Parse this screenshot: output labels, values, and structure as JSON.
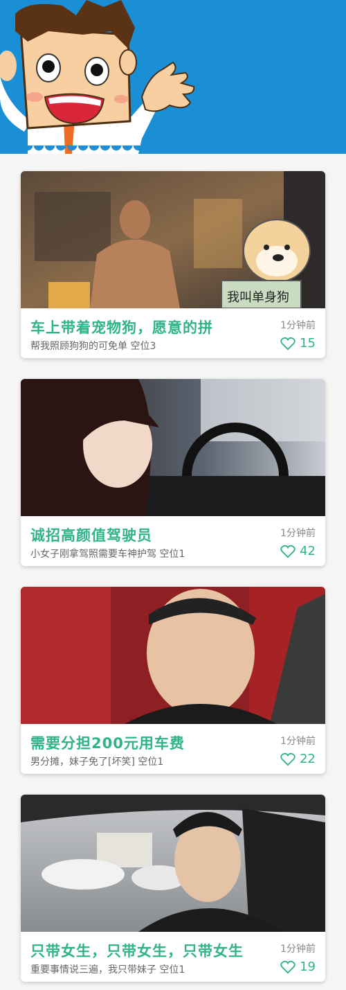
{
  "cards": [
    {
      "title": "车上带着宠物狗，愿意的拼",
      "subtitle": "帮我照顾狗狗的可免单  空位3",
      "time": "1分钟前",
      "likes": "15",
      "sign_text": "我叫单身狗"
    },
    {
      "title": "诚招高颜值驾驶员",
      "subtitle": "小女子刚拿驾照需要车神护驾  空位1",
      "time": "1分钟前",
      "likes": "42"
    },
    {
      "title": "需要分担200元用车费",
      "subtitle": "男分摊，妹子免了[坏笑]  空位1",
      "time": "1分钟前",
      "likes": "22"
    },
    {
      "title": "只带女生，只带女生，只带女生",
      "subtitle": "重要事情说三遍，我只带妹子  空位1",
      "time": "1分钟前",
      "likes": "19"
    }
  ],
  "colors": {
    "header": "#1b8fd6",
    "accent": "#2fb38a",
    "heart": "heart-outline-icon"
  }
}
